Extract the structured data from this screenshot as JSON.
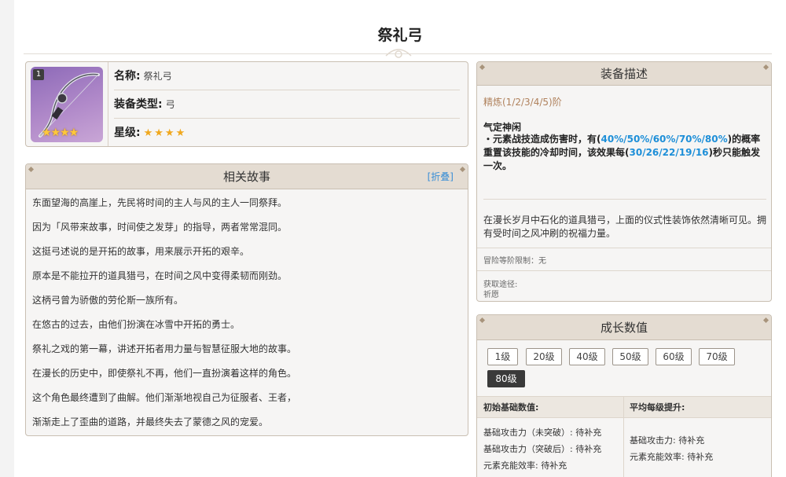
{
  "page_title": "祭礼弓",
  "info": {
    "level_badge": "1",
    "name_key": "名称:",
    "name_value": "祭礼弓",
    "type_key": "装备类型:",
    "type_value": "弓",
    "rarity_key": "星级:",
    "rarity_stars": "★★★★"
  },
  "story": {
    "header": "相关故事",
    "fold_label": "[折叠]",
    "lines": [
      "东面望海的高崖上，先民将时间的主人与风的主人一同祭拜。",
      "因为「风带来故事，时间使之发芽」的指导，两者常常混同。",
      "这挺弓述说的是开拓的故事，用来展示开拓的艰辛。",
      "原本是不能拉开的道具猎弓，在时间之风中变得柔韧而刚劲。",
      "这柄弓曾为骄傲的劳伦斯一族所有。",
      "在悠古的过去，由他们扮演在冰雪中开拓的勇士。",
      "祭礼之戏的第一幕，讲述开拓者用力量与智慧征服大地的故事。",
      "在漫长的历史中，即使祭礼不再，他们一直扮演着这样的角色。",
      "这个角色最终遭到了曲解。他们渐渐地视自己为征服者、王者，",
      "渐渐走上了歪曲的道路，并最终失去了蒙德之风的宠爱。"
    ]
  },
  "desc": {
    "header": "装备描述",
    "refine": "精炼(1/2/3/4/5)阶",
    "skill_name": "气定神闲",
    "skill_p1": "・元素战技造成伤害时，有(",
    "skill_hl1": "40%/50%/60%/70%/80%",
    "skill_p2": ")的概率重置该技能的冷却时间，该效果每(",
    "skill_hl2": "30/26/22/19/16",
    "skill_p3": ")秒只能触发一次。",
    "flavor": "在漫长岁月中石化的道具猎弓，上面的仪式性装饰依然清晰可见。拥有受时间之风冲刷的祝福力量。",
    "limit": "冒险等阶限制：无",
    "obtain_key": "获取途径:",
    "obtain_value": "祈愿"
  },
  "growth": {
    "header": "成长数值",
    "levels": [
      "1级",
      "20级",
      "40级",
      "50级",
      "60级",
      "70级",
      "80级"
    ],
    "active_level": "80级",
    "initial_header": "初始基础数值:",
    "avg_header": "平均每级提升:",
    "initial_stats": [
      "基础攻击力（未突破）: 待补充",
      "基础攻击力（突破后）: 待补充",
      "元素充能效率: 待补充"
    ],
    "avg_stats": [
      "基础攻击力: 待补充",
      "元素充能效率: 待补充"
    ]
  },
  "colors": {
    "panel_bg": "#f6f5f4",
    "panel_head": "#e4dcd2",
    "border": "#c9bfb2",
    "highlight": "#1e8fd8",
    "refine": "#b0825d",
    "star": "#f0a81e"
  }
}
